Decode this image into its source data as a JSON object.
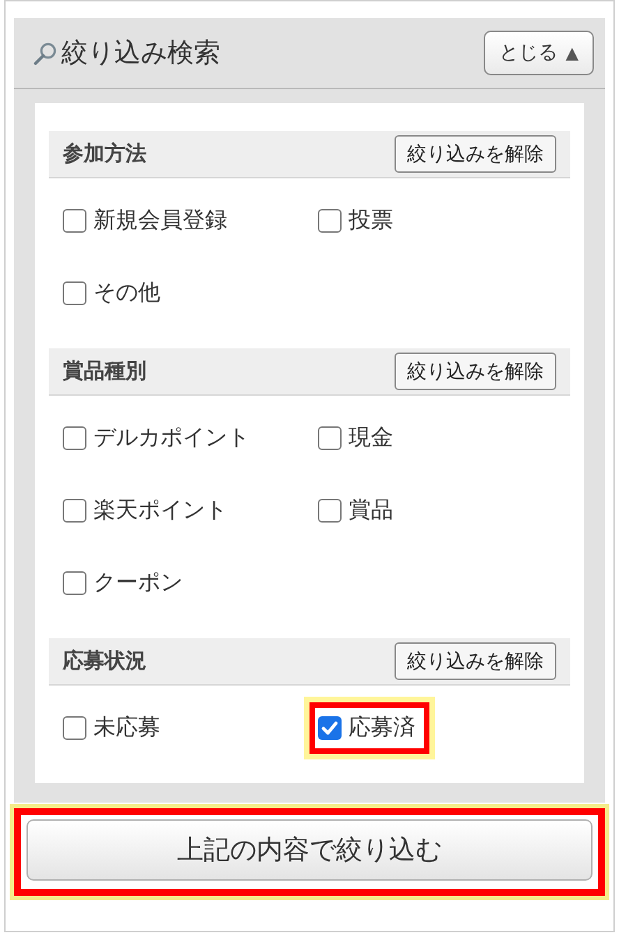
{
  "header": {
    "title": "絞り込み検索",
    "close_button": "とじる",
    "close_glyph": "▲"
  },
  "sections": [
    {
      "title": "参加方法",
      "clear_button": "絞り込みを解除",
      "options": [
        {
          "label": "新規会員登録",
          "checked": false,
          "highlighted": false
        },
        {
          "label": "投票",
          "checked": false,
          "highlighted": false
        },
        {
          "label": "その他",
          "checked": false,
          "highlighted": false
        }
      ]
    },
    {
      "title": "賞品種別",
      "clear_button": "絞り込みを解除",
      "options": [
        {
          "label": "デルカポイント",
          "checked": false,
          "highlighted": false
        },
        {
          "label": "現金",
          "checked": false,
          "highlighted": false
        },
        {
          "label": "楽天ポイント",
          "checked": false,
          "highlighted": false
        },
        {
          "label": "賞品",
          "checked": false,
          "highlighted": false
        },
        {
          "label": "クーポン",
          "checked": false,
          "highlighted": false
        }
      ]
    },
    {
      "title": "応募状況",
      "clear_button": "絞り込みを解除",
      "options": [
        {
          "label": "未応募",
          "checked": false,
          "highlighted": false
        },
        {
          "label": "応募済",
          "checked": true,
          "highlighted": true
        }
      ]
    }
  ],
  "submit_button": {
    "label": "上記の内容で絞り込む",
    "highlighted": true
  }
}
